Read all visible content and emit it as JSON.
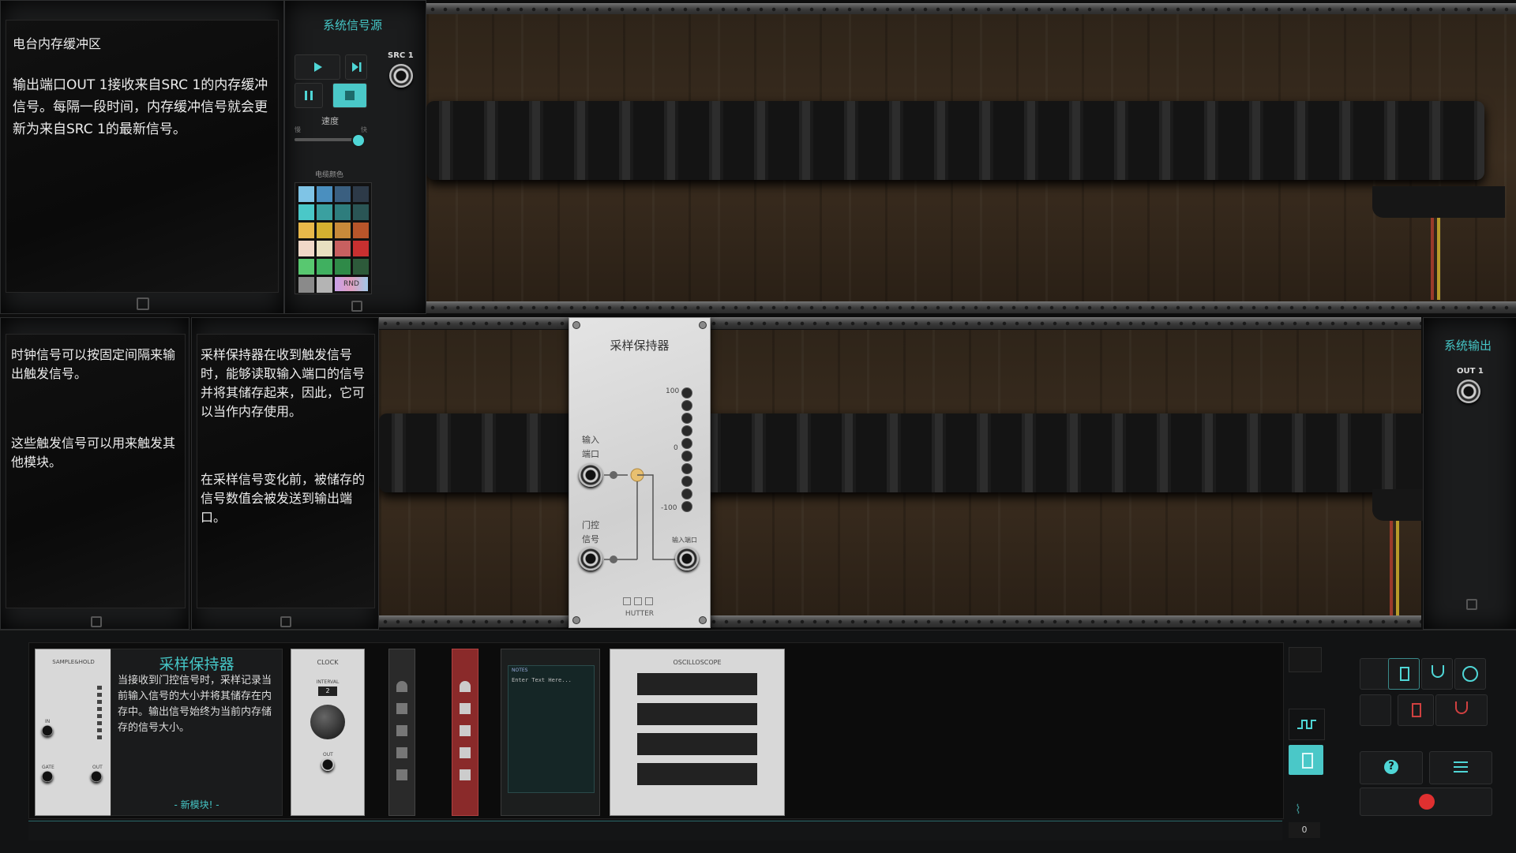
{
  "info_panel": {
    "title": "电台内存缓冲区",
    "body": "输出端口OUT 1接收来自SRC 1的内存缓冲信号。每隔一段时间，内存缓冲信号就会更新为来自SRC 1的最新信号。"
  },
  "source_panel": {
    "title": "系统信号源",
    "src_label": "SRC 1",
    "speed_label": "速度",
    "slow_label": "慢",
    "fast_label": "快",
    "speed_value": 0.9,
    "color_label": "电缆颜色",
    "rnd_label": "RND",
    "swatches": [
      "#7fc4e6",
      "#4a8fbf",
      "#3a5f80",
      "#2d3a48",
      "#4ac8c8",
      "#3aa0a0",
      "#2e7d7d",
      "#2a5555",
      "#e8b84a",
      "#d4b030",
      "#c88a3a",
      "#b8552a",
      "#f0d8c8",
      "#e8e0c0",
      "#c86060",
      "#c83030",
      "#58c870",
      "#40b060",
      "#2f8a48",
      "#2d5a3a",
      "#8a8a8a",
      "#b4b4b4"
    ]
  },
  "hint_clock": {
    "p1": "时钟信号可以按固定间隔来输出触发信号。",
    "p2": "这些触发信号可以用来触发其他模块。"
  },
  "hint_sh": {
    "p1": "采样保持器在收到触发信号时，能够读取输入端口的信号并将其储存起来，因此，它可以当作内存使用。",
    "p2": "在采样信号变化前，被储存的信号数值会被发送到输出端口。"
  },
  "module": {
    "title": "采样保持器",
    "scale_top": "100",
    "scale_mid": "0",
    "scale_bottom": "-100",
    "input_label": "输入\n端口",
    "gate_label": "门控\n信号",
    "output_label": "输入端口",
    "brand": "HUTTER"
  },
  "system_output": {
    "title": "系统输出",
    "out_label": "OUT 1"
  },
  "tray": {
    "sh_card_name": "SAMPLE&HOLD",
    "sh_card_in": "IN",
    "sh_card_gate": "GATE",
    "sh_card_out": "OUT",
    "desc_title": "采样保持器",
    "desc_body": "当接收到门控信号时，采样记录当前输入信号的大小并将其储存在内存中。输出信号始终为当前内存储存的信号大小。",
    "new_module": "- 新模块! -",
    "clock_name": "CLOCK",
    "clock_interval_label": "INTERVAL",
    "clock_interval_value": "2",
    "clock_out": "OUT",
    "notes_title": "NOTES",
    "notes_placeholder": "Enter Text Here...",
    "osc_name": "OSCILLOSCOPE",
    "counter_value": "0"
  }
}
